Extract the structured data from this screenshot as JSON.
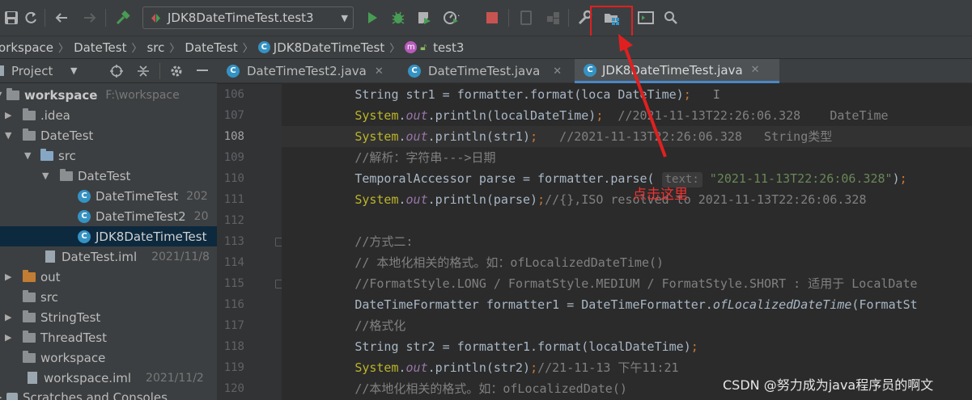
{
  "toolbar": {
    "run_config_label": "JDK8DateTimeTest.test3",
    "icons": [
      "save-icon",
      "sync-icon",
      "back-icon",
      "forward-icon",
      "build-hammer-icon",
      "run-icon",
      "debug-icon",
      "coverage-icon",
      "profile-icon",
      "stop-icon",
      "device-icon",
      "project-structure-icon",
      "settings-wrench-icon",
      "project-structure-highlight-icon",
      "terminal-icon",
      "search-icon"
    ]
  },
  "breadcrumb": {
    "items": [
      "orkspace",
      "DateTest",
      "src",
      "DateTest",
      "JDK8DateTimeTest",
      "test3"
    ]
  },
  "project_panel": {
    "title": "Project",
    "tree": [
      {
        "label": "workspace",
        "meta": "F:\\workspace"
      },
      {
        "label": ".idea",
        "meta": ""
      },
      {
        "label": "DateTest",
        "meta": ""
      },
      {
        "label": "src",
        "meta": ""
      },
      {
        "label": "DateTest",
        "meta": ""
      },
      {
        "label": "DateTimeTest",
        "meta": "202"
      },
      {
        "label": "DateTimeTest2",
        "meta": "20"
      },
      {
        "label": "JDK8DateTimeTest",
        "meta": ""
      },
      {
        "label": "DateTest.iml",
        "meta": "2021/11/8"
      },
      {
        "label": "out",
        "meta": ""
      },
      {
        "label": "src",
        "meta": ""
      },
      {
        "label": "StringTest",
        "meta": ""
      },
      {
        "label": "ThreadTest",
        "meta": ""
      },
      {
        "label": "workspace",
        "meta": ""
      },
      {
        "label": "workspace.iml",
        "meta": "2021/11/2"
      },
      {
        "label": "Scratches and Consoles",
        "meta": ""
      }
    ]
  },
  "tabs": [
    {
      "label": "DateTimeTest2.java"
    },
    {
      "label": "DateTimeTest.java"
    },
    {
      "label": "JDK8DateTimeTest.java"
    }
  ],
  "editor": {
    "line_numbers": [
      "106",
      "107",
      "108",
      "109",
      "110",
      "111",
      "112",
      "113",
      "114",
      "115",
      "116",
      "117",
      "118",
      "119",
      "120"
    ],
    "current_line": "108"
  },
  "annotation": {
    "text": "点击这里"
  },
  "watermark": "CSDN @努力成为java程序员的啊文",
  "colors": {
    "keyword": "#cc7832",
    "string": "#6a8759",
    "comment": "#808080",
    "field": "#9876aa",
    "annotation_red": "#e02020",
    "selection": "#0d293e",
    "active_tab_underline": "#4a88c7"
  }
}
